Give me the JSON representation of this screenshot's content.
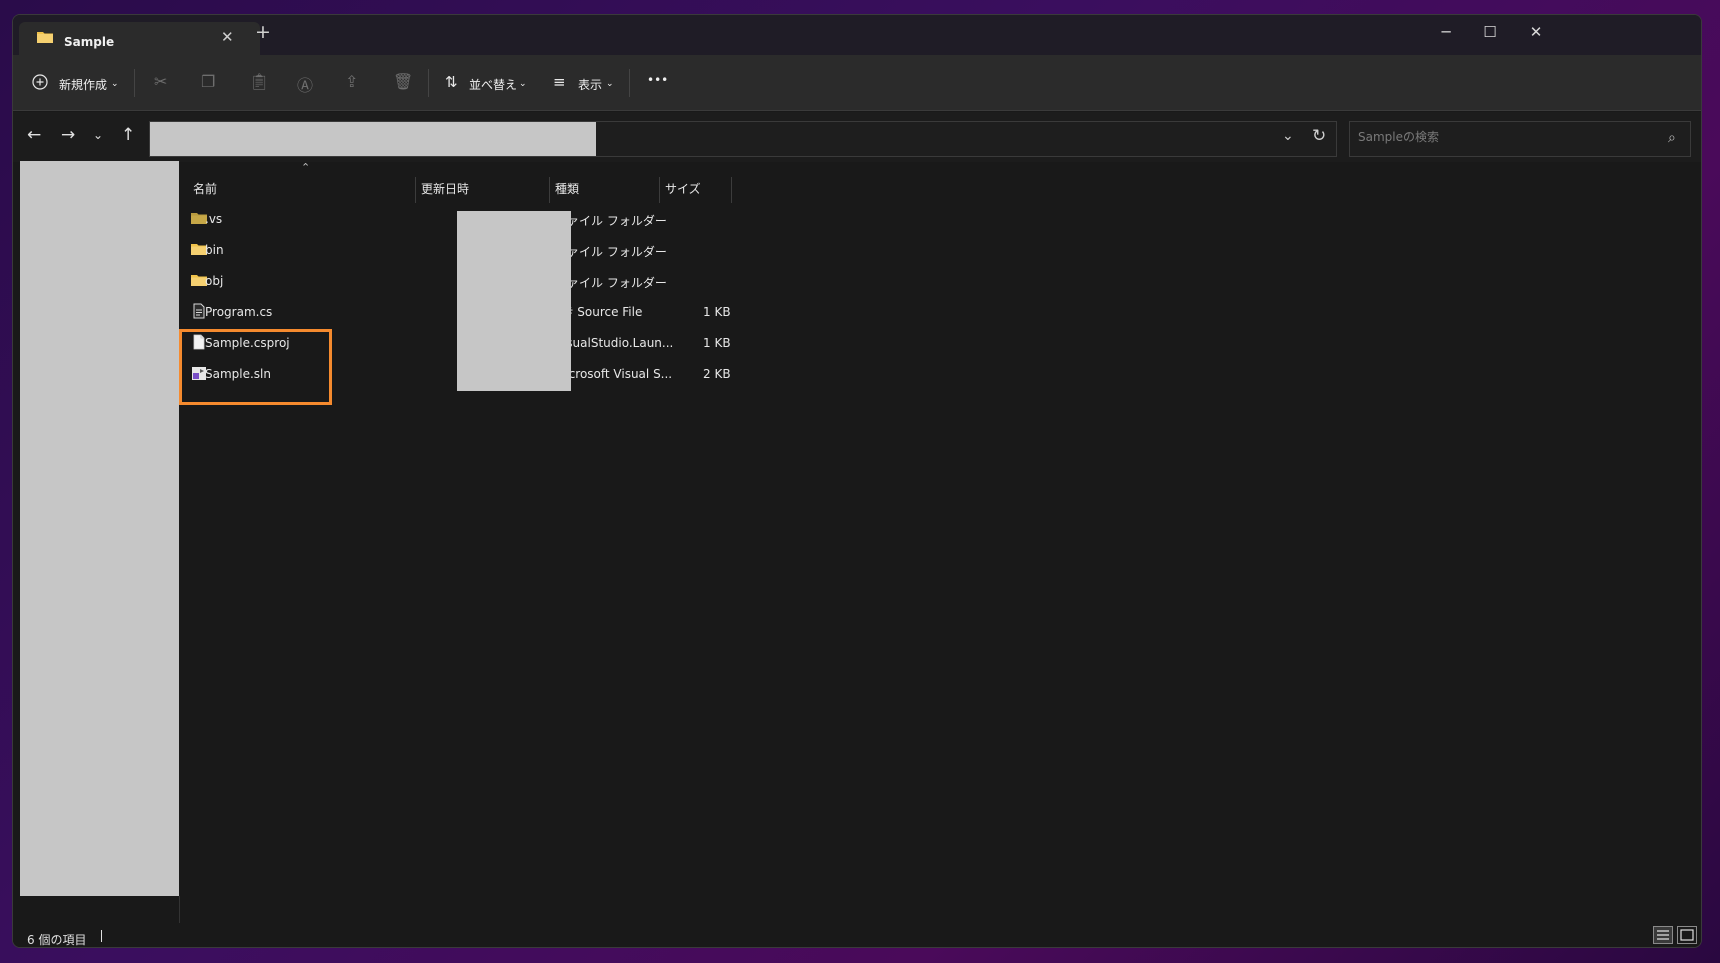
{
  "window": {
    "tab_title": "Sample",
    "tab_close": "✕",
    "new_tab": "+",
    "minimize": "─",
    "maximize": "☐",
    "close": "✕"
  },
  "toolbar": {
    "new_label": "新規作成",
    "sort_label": "並べ替え",
    "view_label": "表示",
    "more": "•••"
  },
  "address": {
    "search_placeholder": "Sampleの検索"
  },
  "columns": {
    "name": "名前",
    "date": "更新日時",
    "type": "種類",
    "size": "サイズ"
  },
  "files": [
    {
      "name": ".vs",
      "type": "ファイル フォルダー",
      "size": "",
      "icon": "folder-hidden-icon"
    },
    {
      "name": "bin",
      "type": "ファイル フォルダー",
      "size": "",
      "icon": "folder-icon"
    },
    {
      "name": "obj",
      "type": "ファイル フォルダー",
      "size": "",
      "icon": "folder-icon"
    },
    {
      "name": "Program.cs",
      "type": "C# Source File",
      "size": "1 KB",
      "icon": "cs-file-icon"
    },
    {
      "name": "Sample.csproj",
      "type": "VisualStudio.Laun...",
      "size": "1 KB",
      "icon": "file-icon"
    },
    {
      "name": "Sample.sln",
      "type": "Microsoft Visual S...",
      "size": "2 KB",
      "icon": "sln-file-icon"
    }
  ],
  "status": {
    "item_count": "6 個の項目"
  },
  "colors": {
    "accent_highlight": "#f58a2e",
    "folder": "#f0c24a",
    "background": "#191919"
  }
}
